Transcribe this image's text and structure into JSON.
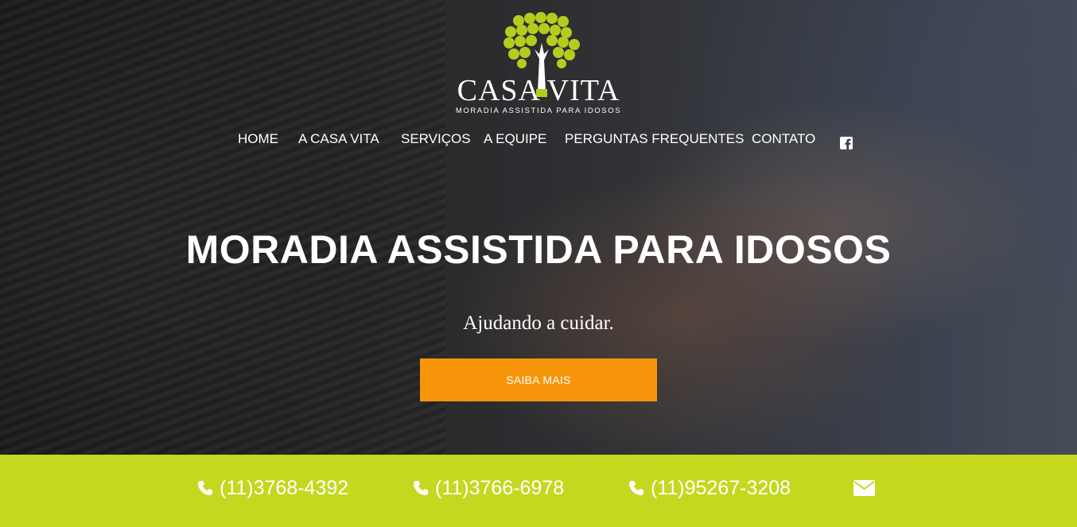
{
  "logo": {
    "name": "CASA VITA",
    "tagline": "MORADIA ASSISTIDA PARA IDOSOS",
    "leaf_color": "#b5cc1f"
  },
  "nav": {
    "items": [
      "HOME",
      "A CASA VITA",
      "SERVIÇOS",
      "A EQUIPE",
      "PERGUNTAS FREQUENTES",
      "CONTATO"
    ],
    "social_icon": "facebook-icon"
  },
  "hero": {
    "headline": "MORADIA ASSISTIDA PARA IDOSOS",
    "subheadline": "Ajudando a cuidar.",
    "cta_label": "SAIBA MAIS",
    "cta_color": "#f7960b"
  },
  "contact": {
    "bar_color": "#c4d81f",
    "phones": [
      "(11)3768-4392",
      "(11)3766-6978",
      "(11)95267-3208"
    ],
    "phone_icon": "phone-icon",
    "email_icon": "envelope-icon"
  }
}
